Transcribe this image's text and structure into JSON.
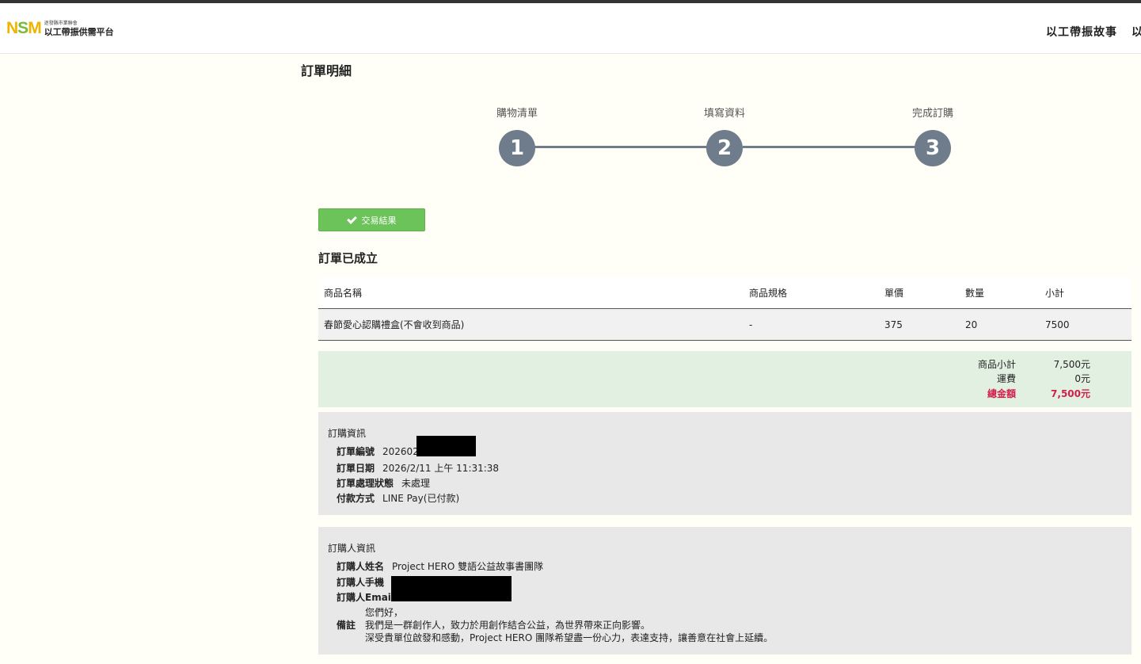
{
  "header": {
    "logo_mark": {
      "n": "N",
      "s": "S",
      "m": "M"
    },
    "logo_small": "逐發縣市業聯會",
    "logo_main": "以工帶振供需平台",
    "nav": [
      "以工帶振故事",
      "以"
    ]
  },
  "page_title": "訂單明細",
  "steps": [
    {
      "label": "購物清單",
      "number": "1"
    },
    {
      "label": "填寫資料",
      "number": "2"
    },
    {
      "label": "完成訂購",
      "number": "3"
    }
  ],
  "result_button": {
    "label": "交易結果",
    "icon": "check-icon"
  },
  "order_created": "訂單已成立",
  "table": {
    "headers": [
      "商品名稱",
      "商品規格",
      "單價",
      "數量",
      "小計"
    ],
    "rows": [
      {
        "name": "春節愛心認購禮盒(不會收到商品)",
        "spec": "-",
        "price": "375",
        "qty": "20",
        "subtotal": "7500"
      }
    ]
  },
  "summary": {
    "subtotal_label": "商品小計",
    "subtotal_value": "7,500元",
    "shipping_label": "運費",
    "shipping_value": "0元",
    "total_label": "總金額",
    "total_value": "7,500元"
  },
  "order_info": {
    "title": "訂購資訊",
    "number_label": "訂單編號",
    "number_value": "202602",
    "date_label": "訂單日期",
    "date_value": "2026/2/11 上午 11:31:38",
    "status_label": "訂單處理狀態",
    "status_value": "未處理",
    "payment_label": "付款方式",
    "payment_value": "LINE Pay(已付款)"
  },
  "buyer_info": {
    "title": "訂購人資訊",
    "name_label": "訂購人姓名",
    "name_value": "Project HERO 雙語公益故事書團隊",
    "phone_label": "訂購人手機",
    "email_label": "訂購人Email",
    "note_label": "備註",
    "note_lines": [
      "您們好，",
      "我們是一群創作人，致力於用創作結合公益，為世界帶來正向影響。",
      "深受貴單位啟發和感動，Project HERO 團隊希望盡一份心力，表達支持，讓善意在社會上延續。"
    ]
  },
  "colors": {
    "step": "#6e7c8c",
    "button": "#6cc35a",
    "total": "#d0204a",
    "summary_bg": "#e2f0e2"
  }
}
